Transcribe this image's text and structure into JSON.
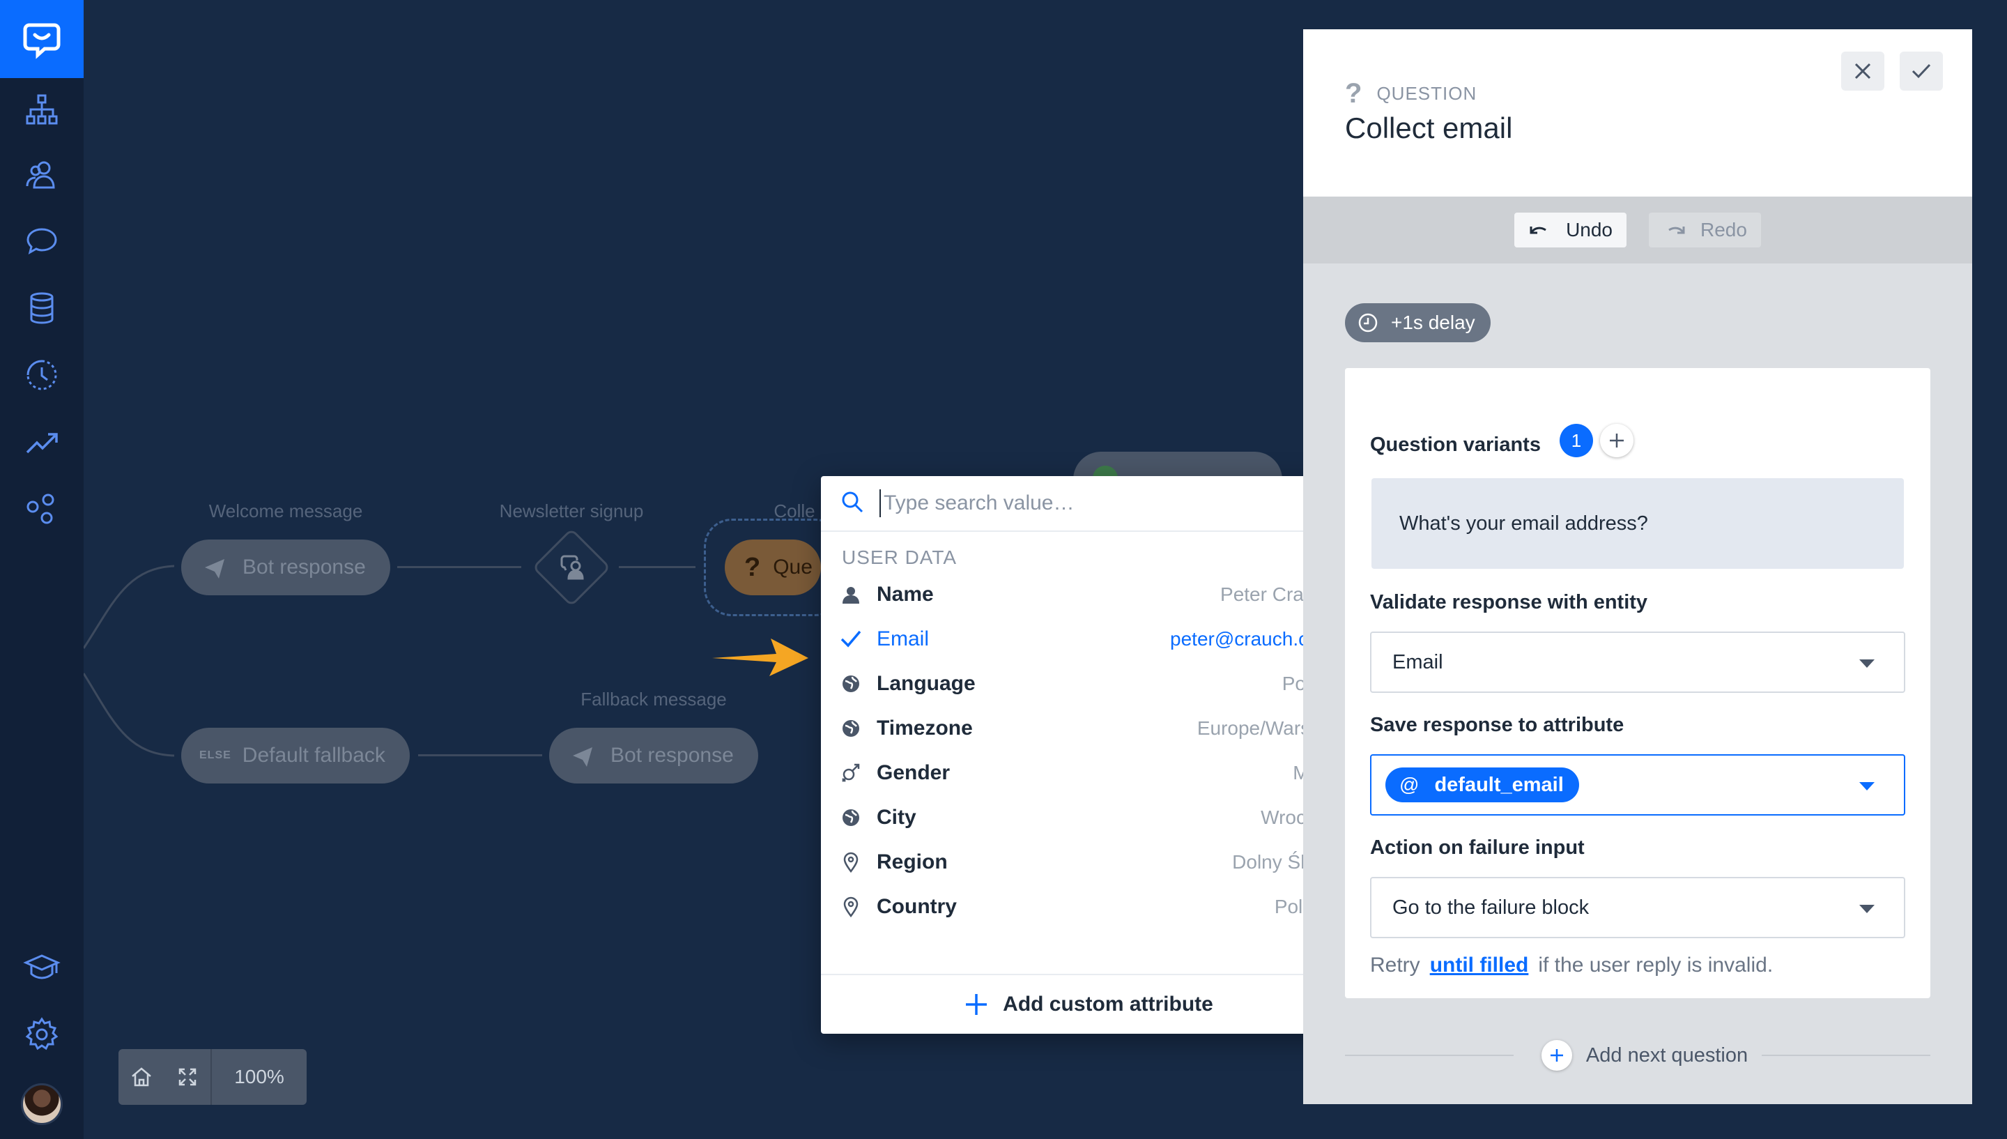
{
  "sidebar": {
    "items": [
      "logo-icon",
      "flow-icon",
      "users-icon",
      "chat-icon",
      "database-icon",
      "history-icon",
      "analytics-icon",
      "integrations-icon",
      "academy-icon",
      "settings-icon"
    ]
  },
  "canvas": {
    "welcome_label": "Welcome message",
    "welcome_pill": "Bot response",
    "newsletter_label": "Newsletter signup",
    "collect_label": "Colle",
    "collect_pill": "Que",
    "fallback_label": "Fallback message",
    "else_tag": "ELSE",
    "default_pill": "Default fallback",
    "fallback_pill": "Bot response",
    "zoom_value": "100%"
  },
  "dropdown": {
    "search_placeholder": "Type search value…",
    "section_title": "USER DATA",
    "items": [
      {
        "label": "Name",
        "value": "Peter Crauch",
        "icon": "person-icon"
      },
      {
        "label": "Email",
        "value": "peter@crauch.com",
        "icon": "check-icon",
        "selected": true
      },
      {
        "label": "Language",
        "value": "Polish",
        "icon": "globe-icon"
      },
      {
        "label": "Timezone",
        "value": "Europe/Warsaw",
        "icon": "globe-icon"
      },
      {
        "label": "Gender",
        "value": "Male",
        "icon": "gender-icon"
      },
      {
        "label": "City",
        "value": "Wroclaw",
        "icon": "globe-icon"
      },
      {
        "label": "Region",
        "value": "Dolny Śląsk",
        "icon": "pin-icon"
      },
      {
        "label": "Country",
        "value": "Poland",
        "icon": "pin-icon"
      }
    ],
    "footer": "Add custom attribute"
  },
  "panel": {
    "kicker": "QUESTION",
    "title": "Collect email",
    "undo": "Undo",
    "redo": "Redo",
    "delay": "+1s delay",
    "variants_label": "Question variants",
    "variants_count": "1",
    "variant_text": "What's your email address?",
    "validate_label": "Validate response with entity",
    "validate_value": "Email",
    "save_label": "Save response to attribute",
    "attr_at": "@",
    "attr_value": "default_email",
    "failure_label": "Action on failure input",
    "failure_value": "Go to the failure block",
    "retry_pre": "Retry",
    "retry_link": "until filled",
    "retry_post": "if the user reply is invalid.",
    "next_question": "Add next question"
  },
  "colors": {
    "accent": "#0a6cff",
    "arrow": "#f5a623",
    "background": "#172a45"
  }
}
